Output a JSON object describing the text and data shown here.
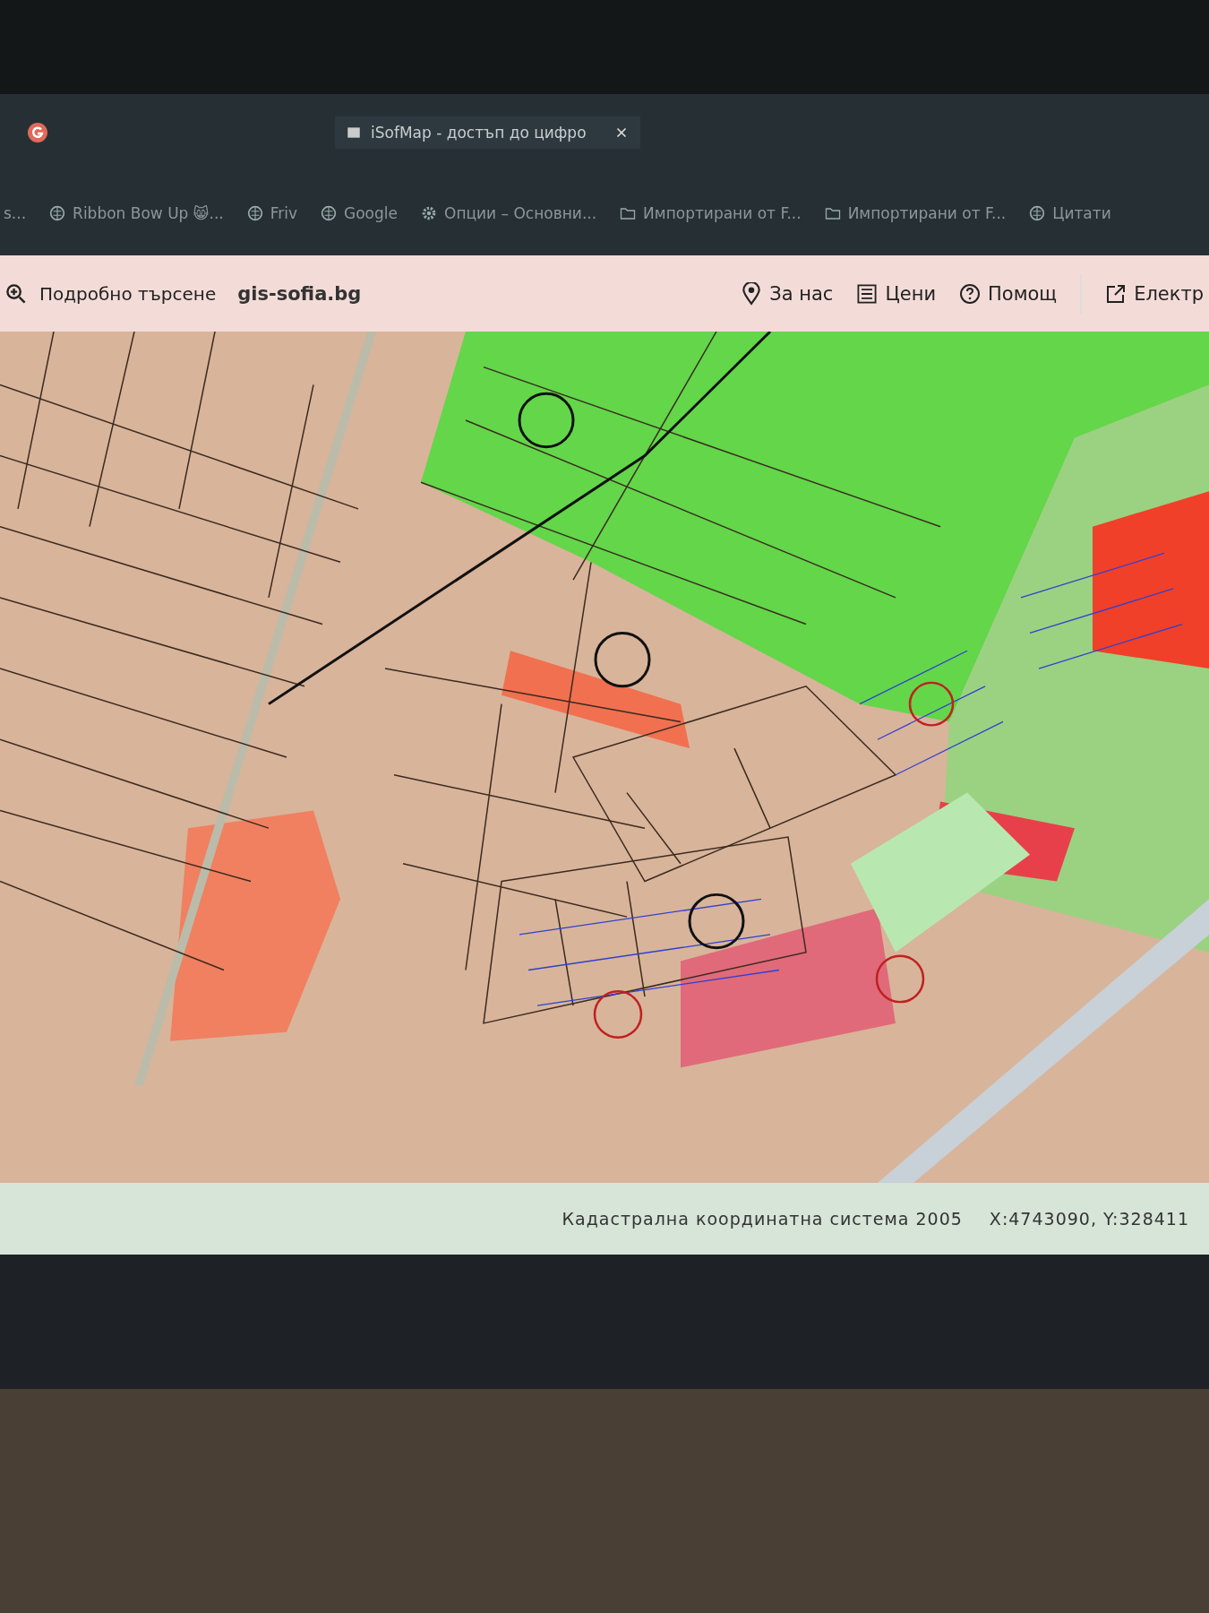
{
  "browser": {
    "tabs": [
      {
        "title": "iSofMap - достъп до цифро",
        "selected": true
      }
    ],
    "bookmarks": [
      {
        "label": "s...",
        "kind": "plain"
      },
      {
        "label": "Ribbon Bow Up 😸...",
        "kind": "globe"
      },
      {
        "label": "Friv",
        "kind": "globe"
      },
      {
        "label": "Google",
        "kind": "globe"
      },
      {
        "label": "Опции – Основни...",
        "kind": "gear"
      },
      {
        "label": "Импортирани от F...",
        "kind": "folder"
      },
      {
        "label": "Импортирани от F...",
        "kind": "folder"
      },
      {
        "label": "Цитати",
        "kind": "globe"
      }
    ]
  },
  "toolbar": {
    "search_link": "Подробно търсене",
    "site": "gis-sofia.bg",
    "nav": [
      {
        "label": "За нас",
        "kind": "pin"
      },
      {
        "label": "Цени",
        "kind": "list"
      },
      {
        "label": "Помощ",
        "kind": "help"
      },
      {
        "label": "Електр",
        "kind": "external"
      }
    ]
  },
  "status_bar": {
    "system": "Кадастрална координатна система 2005",
    "coordinates": "X:4743090, Y:328411"
  }
}
